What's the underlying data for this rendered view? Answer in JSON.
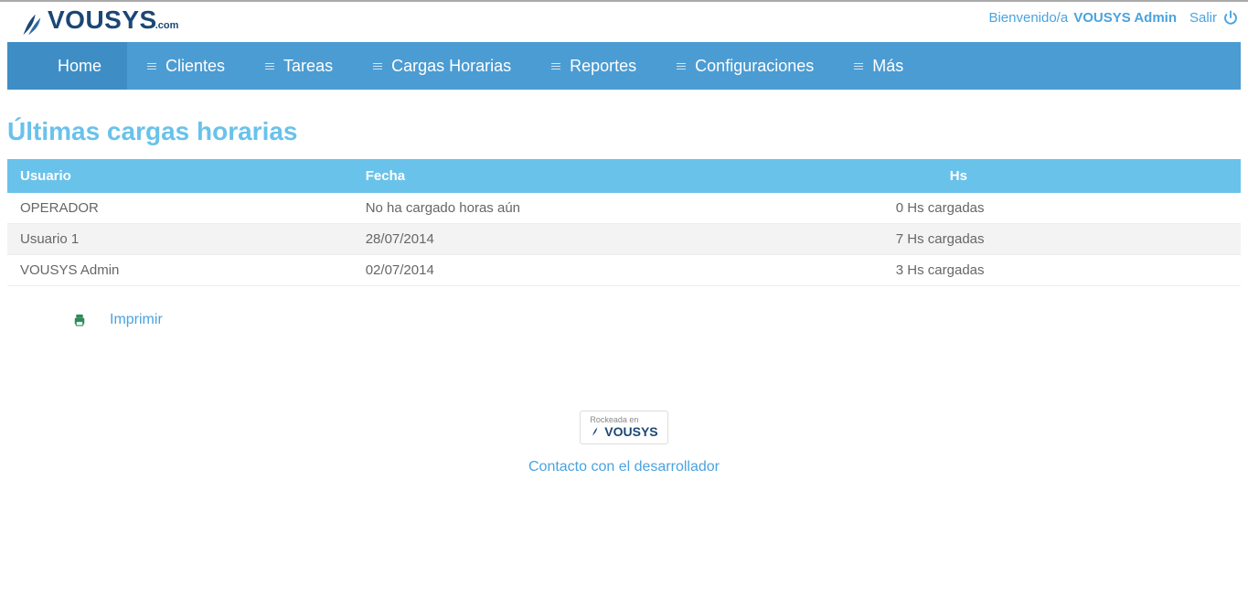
{
  "header": {
    "welcome_prefix": "Bienvenido/a",
    "user_name": "VOUSYS Admin",
    "logout_label": "Salir",
    "logo_text": "VOUSYS",
    "logo_suffix": ".com"
  },
  "nav": {
    "items": [
      "Home",
      "Clientes",
      "Tareas",
      "Cargas Horarias",
      "Reportes",
      "Configuraciones",
      "Más"
    ]
  },
  "page": {
    "title": "Últimas cargas horarias"
  },
  "table": {
    "columns": [
      "Usuario",
      "Fecha",
      "Hs"
    ],
    "rows": [
      {
        "usuario": "OPERADOR",
        "fecha": "No ha cargado horas aún",
        "hs": "0 Hs cargadas"
      },
      {
        "usuario": "Usuario 1",
        "fecha": "28/07/2014",
        "hs": "7 Hs cargadas"
      },
      {
        "usuario": "VOUSYS Admin",
        "fecha": "02/07/2014",
        "hs": "3 Hs cargadas"
      }
    ]
  },
  "actions": {
    "print_label": "Imprimir"
  },
  "footer": {
    "rock_label": "Rockeada en",
    "logo_text": "VOUSYS",
    "contact_label": "Contacto con el desarrollador"
  }
}
